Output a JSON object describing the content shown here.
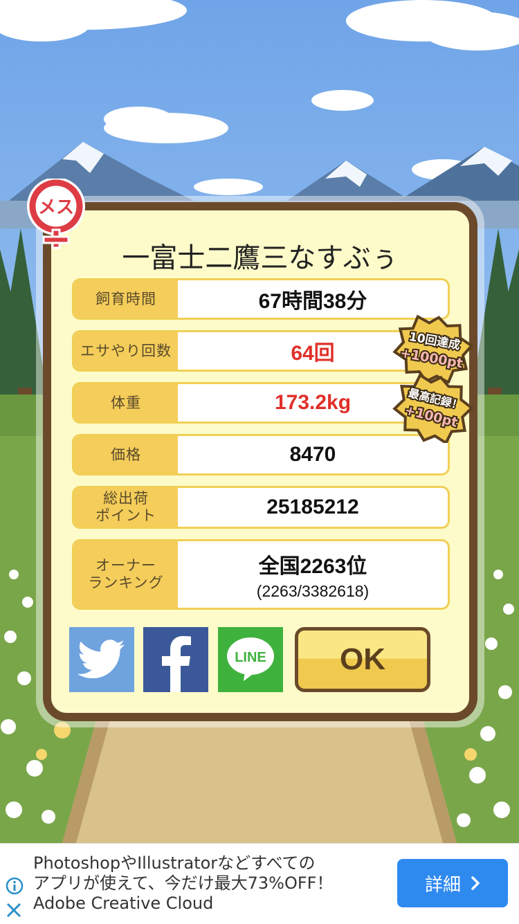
{
  "dialog": {
    "title": "一富士二鷹三なすぶぅ",
    "gender_badge": "メス",
    "rows": [
      {
        "label": "飼育時間",
        "value": "67時間38分"
      },
      {
        "label": "エサやり回数",
        "value": "64回"
      },
      {
        "label": "体重",
        "value": "173.2kg"
      },
      {
        "label": "価格",
        "value": "8470"
      },
      {
        "label_line1": "総出荷",
        "label_line2": "ポイント",
        "value": "25185212"
      },
      {
        "label_line1": "オーナー",
        "label_line2": "ランキング",
        "value": "全国2263位",
        "sub": "(2263/3382618)"
      }
    ],
    "badges": [
      {
        "line1": "10回達成",
        "line2": "+1000pt"
      },
      {
        "line1": "最高記録！",
        "line2": "+100pt"
      }
    ],
    "share": {
      "twitter_icon": "twitter-bird-icon",
      "facebook_icon": "facebook-f-icon",
      "line_label": "LINE"
    },
    "ok_label": "OK"
  },
  "ad": {
    "line1": "PhotoshopやIllustratorなどすべての",
    "line2": "アプリが使えて、今だけ最大73%OFF！",
    "line3": "Adobe Creative Cloud",
    "button_label": "詳細",
    "button_icon": "chevron-right-icon"
  },
  "colors": {
    "accent_red": "#e0302a",
    "frame_brown": "#6b4a2b",
    "label_yellow": "#f4cd5a",
    "ad_blue": "#2f8af0"
  }
}
